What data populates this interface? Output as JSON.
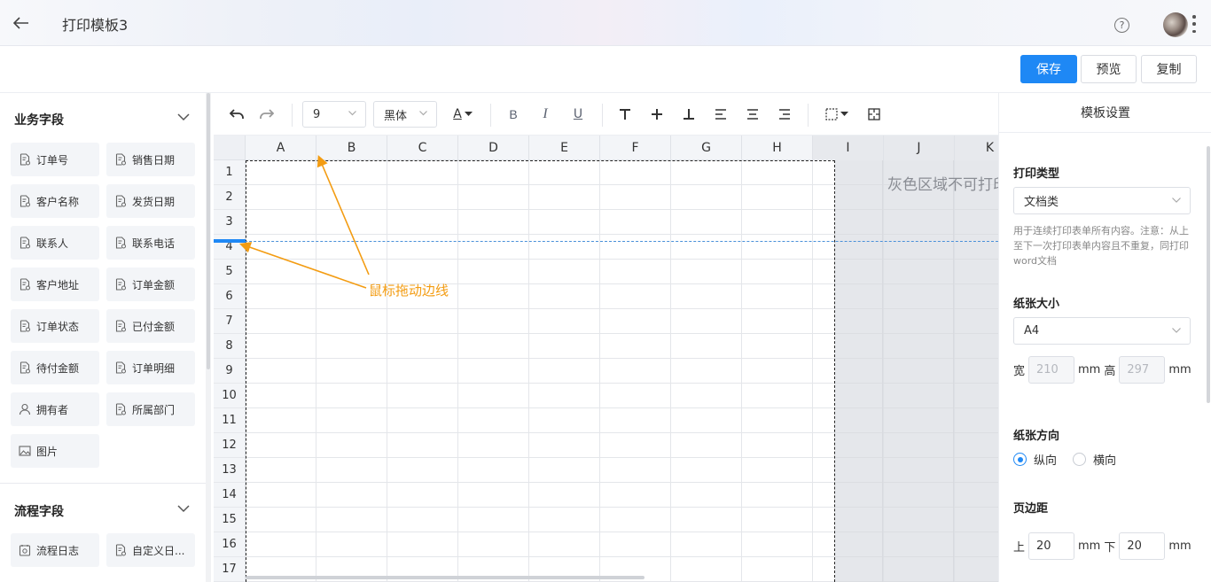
{
  "header": {
    "title": "打印模板3"
  },
  "actions": {
    "save": "保存",
    "preview": "预览",
    "copy": "复制"
  },
  "business_fields": {
    "title": "业务字段",
    "items": [
      {
        "label": "订单号",
        "icon": "document-icon"
      },
      {
        "label": "销售日期",
        "icon": "document-icon"
      },
      {
        "label": "客户名称",
        "icon": "document-icon"
      },
      {
        "label": "发货日期",
        "icon": "document-icon"
      },
      {
        "label": "联系人",
        "icon": "document-icon"
      },
      {
        "label": "联系电话",
        "icon": "document-icon"
      },
      {
        "label": "客户地址",
        "icon": "document-icon"
      },
      {
        "label": "订单金额",
        "icon": "document-icon"
      },
      {
        "label": "订单状态",
        "icon": "document-icon"
      },
      {
        "label": "已付金额",
        "icon": "document-icon"
      },
      {
        "label": "待付金额",
        "icon": "document-icon"
      },
      {
        "label": "订单明细",
        "icon": "document-icon"
      },
      {
        "label": "拥有者",
        "icon": "user-icon"
      },
      {
        "label": "所属部门",
        "icon": "document-icon"
      },
      {
        "label": "图片",
        "icon": "image-icon"
      }
    ]
  },
  "process_fields": {
    "title": "流程字段",
    "items": [
      {
        "label": "流程日志",
        "icon": "log-icon"
      },
      {
        "label": "自定义日...",
        "icon": "document-icon"
      }
    ]
  },
  "toolbar": {
    "font_size": "9",
    "font_family": "黑体",
    "font_color_glyph": "A",
    "bold": "B",
    "italic": "I",
    "underline": "U"
  },
  "sheet": {
    "columns": [
      "A",
      "B",
      "C",
      "D",
      "E",
      "F",
      "G",
      "H",
      "I",
      "J",
      "K"
    ],
    "rows": [
      "1",
      "2",
      "3",
      "4",
      "5",
      "6",
      "7",
      "8",
      "9",
      "10",
      "11",
      "12",
      "13",
      "14",
      "15",
      "16",
      "17"
    ],
    "grey_note": "灰色区域不可打印",
    "annotation": "鼠标拖动边线"
  },
  "settings": {
    "title": "模板设置",
    "print_type_label": "打印类型",
    "print_type_value": "文档类",
    "print_type_desc": "用于连续打印表单所有内容。注意：从上至下一次打印表单内容且不重复，同打印word文档",
    "paper_size_label": "纸张大小",
    "paper_size_value": "A4",
    "width_label": "宽",
    "width_value": "210",
    "height_label": "高",
    "height_value": "297",
    "unit": "mm",
    "orientation_label": "纸张方向",
    "orientation_options": [
      "纵向",
      "横向"
    ],
    "orientation_selected": "纵向",
    "margin_label": "页边距",
    "margin_top_label": "上",
    "margin_top_value": "20",
    "margin_bottom_label": "下",
    "margin_bottom_value": "20"
  },
  "colors": {
    "accent": "#1e88f5",
    "annotation": "#f39c12"
  }
}
